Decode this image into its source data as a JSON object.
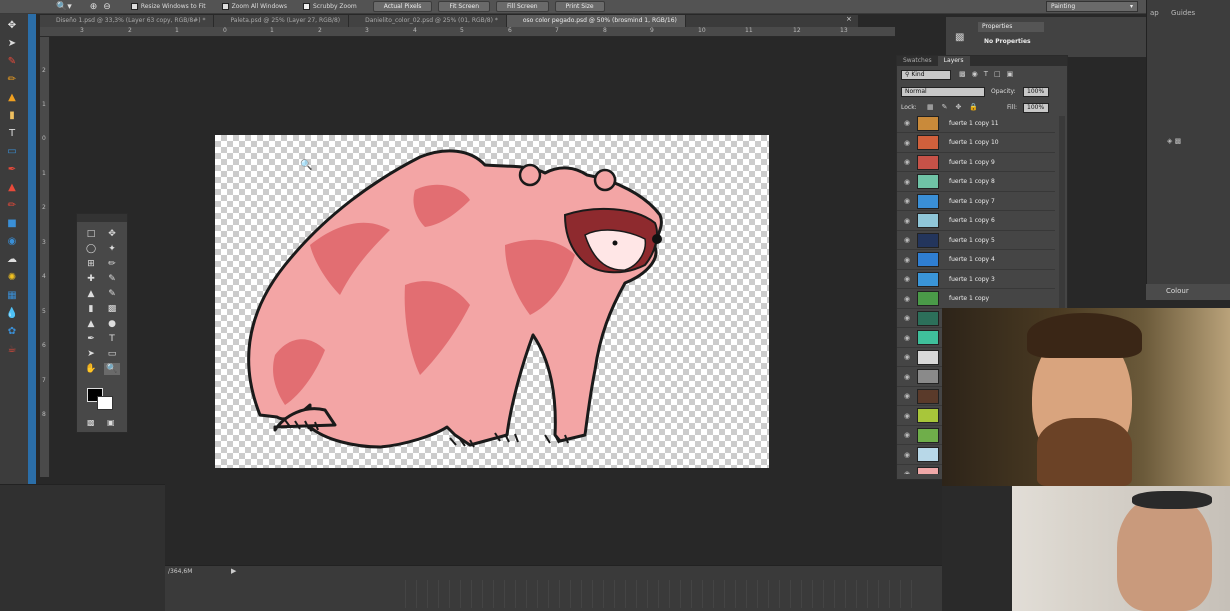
{
  "options_bar": {
    "resize_windows": "Resize Windows to Fit",
    "zoom_all": "Zoom All Windows",
    "scrubby_zoom": "Scrubby Zoom",
    "actual_pixels": "Actual Pixels",
    "fit_screen": "Fit Screen",
    "fill_screen": "Fill Screen",
    "print_size": "Print Size",
    "workspace": "Painting"
  },
  "tabs": [
    {
      "label": "Diseño 1.psd @ 33,3% (Layer 63 copy, RGB/8#) *"
    },
    {
      "label": "Paleta.psd @ 25% (Layer 27, RGB/8)"
    },
    {
      "label": "Danielito_color_02.psd @ 25% (01, RGB/8) *"
    },
    {
      "label": "oso color pegado.psd @ 50% (brosmind 1, RGB/16)"
    }
  ],
  "ruler_ticks_h": [
    "3",
    "2",
    "1",
    "0",
    "1",
    "2",
    "3",
    "4",
    "5",
    "6",
    "7",
    "8",
    "9",
    "10",
    "11",
    "12",
    "13"
  ],
  "ruler_ticks_v": [
    "2",
    "1",
    "0",
    "1",
    "2",
    "3",
    "4",
    "5",
    "6",
    "7",
    "8"
  ],
  "properties": {
    "tab": "Properties",
    "empty": "No Properties"
  },
  "layers_panel": {
    "tabs": [
      "Swatches",
      "Layers"
    ],
    "kind": "Kind",
    "blend_mode": "Normal",
    "opacity_label": "Opacity:",
    "opacity_value": "100%",
    "lock_label": "Lock:",
    "fill_label": "Fill:",
    "fill_value": "100%",
    "layers": [
      {
        "name": "fuerte 1 copy 11",
        "color": "#c98a3a"
      },
      {
        "name": "fuerte 1 copy 10",
        "color": "#d0603c"
      },
      {
        "name": "fuerte 1 copy 9",
        "color": "#c65248"
      },
      {
        "name": "fuerte 1 copy 8",
        "color": "#6fc3a6"
      },
      {
        "name": "fuerte 1 copy 7",
        "color": "#3a8fd6"
      },
      {
        "name": "fuerte 1 copy 6",
        "color": "#8fc6d8"
      },
      {
        "name": "fuerte 1 copy 5",
        "color": "#23355c"
      },
      {
        "name": "fuerte 1 copy 4",
        "color": "#2f7ed1"
      },
      {
        "name": "fuerte 1 copy 3",
        "color": "#3a95d8"
      },
      {
        "name": "fuerte 1 copy",
        "color": "#4a9a48"
      },
      {
        "name": "",
        "color": "#2c6f5a"
      },
      {
        "name": "",
        "color": "#3fbf9b"
      },
      {
        "name": "",
        "color": "#d8d8d8"
      },
      {
        "name": "",
        "color": "#8a8a8a"
      },
      {
        "name": "",
        "color": "#5a3a2a"
      },
      {
        "name": "",
        "color": "#a8c63a"
      },
      {
        "name": "",
        "color": "#6fae4a"
      },
      {
        "name": "",
        "color": "#b8d8e8"
      },
      {
        "name": "",
        "color": "#f0a8a8"
      }
    ]
  },
  "right_dock": {
    "tab_a": "ap",
    "tab_b": "Guides",
    "colour": "Colour"
  },
  "timeline": {
    "frame_label": "/364,6M"
  },
  "colors": {
    "bear": "#f3a5a5",
    "bear_dark": "#e26e72",
    "bear_face": "#8e2a2e"
  }
}
